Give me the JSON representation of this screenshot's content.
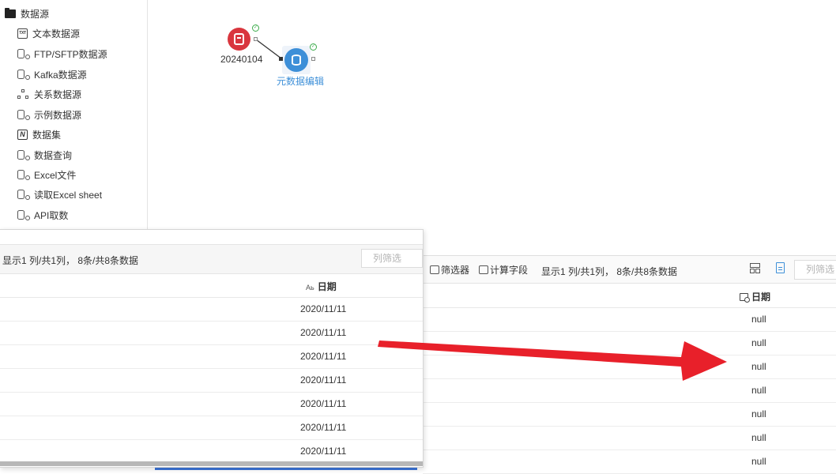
{
  "sidebar": {
    "root_label": "数据源",
    "items": [
      {
        "label": "文本数据源",
        "icon": "text-file-icon"
      },
      {
        "label": "FTP/SFTP数据源",
        "icon": "database-icon"
      },
      {
        "label": "Kafka数据源",
        "icon": "database-icon"
      },
      {
        "label": "关系数据源",
        "icon": "relational-icon"
      },
      {
        "label": "示例数据源",
        "icon": "database-icon"
      },
      {
        "label": "数据集",
        "icon": "dataset-icon"
      },
      {
        "label": "数据查询",
        "icon": "database-icon"
      },
      {
        "label": "Excel文件",
        "icon": "database-icon"
      },
      {
        "label": "读取Excel sheet",
        "icon": "database-icon"
      },
      {
        "label": "API取数",
        "icon": "database-icon"
      }
    ]
  },
  "flow": {
    "source_node_label": "20240104",
    "target_node_label": "元数据编辑"
  },
  "left_preview": {
    "status_text": "显示1 列/共1列， 8条/共8条数据",
    "filter_placeholder": "列筛选",
    "column_type_icon": "Aь",
    "column_name": "日期",
    "rows": [
      "2020/11/11",
      "2020/11/11",
      "2020/11/11",
      "2020/11/11",
      "2020/11/11",
      "2020/11/11",
      "2020/11/11"
    ]
  },
  "right_preview": {
    "filter_button": "筛选器",
    "calc_field_button": "计算字段",
    "status_text": "显示1 列/共1列， 8条/共8条数据",
    "filter_placeholder": "列筛选",
    "column_name": "日期",
    "rows": [
      "null",
      "null",
      "null",
      "null",
      "null",
      "null",
      "null"
    ]
  },
  "colors": {
    "arrow": "#e8202a",
    "source_node": "#d9363e",
    "target_node": "#3d8fd8",
    "target_label": "#3d8fd8",
    "ok_badge": "#3bab4a"
  }
}
